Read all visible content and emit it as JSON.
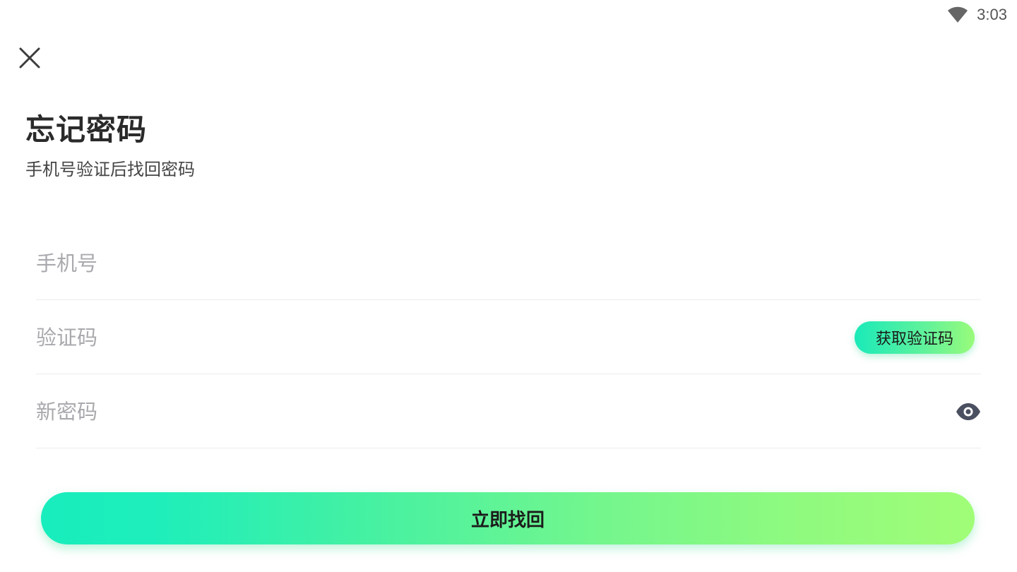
{
  "status_bar": {
    "time": "3:03",
    "wifi_icon": "wifi-icon"
  },
  "header": {
    "close_icon": "close-icon",
    "title": "忘记密码",
    "subtitle": "手机号验证后找回密码"
  },
  "form": {
    "phone": {
      "placeholder": "手机号",
      "value": ""
    },
    "code": {
      "placeholder": "验证码",
      "value": "",
      "button_label": "获取验证码"
    },
    "password": {
      "placeholder": "新密码",
      "value": "",
      "toggle_icon": "eye-icon"
    },
    "submit_label": "立即找回"
  },
  "colors": {
    "gradient_start": "#18edbd",
    "gradient_end": "#a0fd77",
    "placeholder": "#a9a9ae",
    "title": "#2a2a2a"
  }
}
